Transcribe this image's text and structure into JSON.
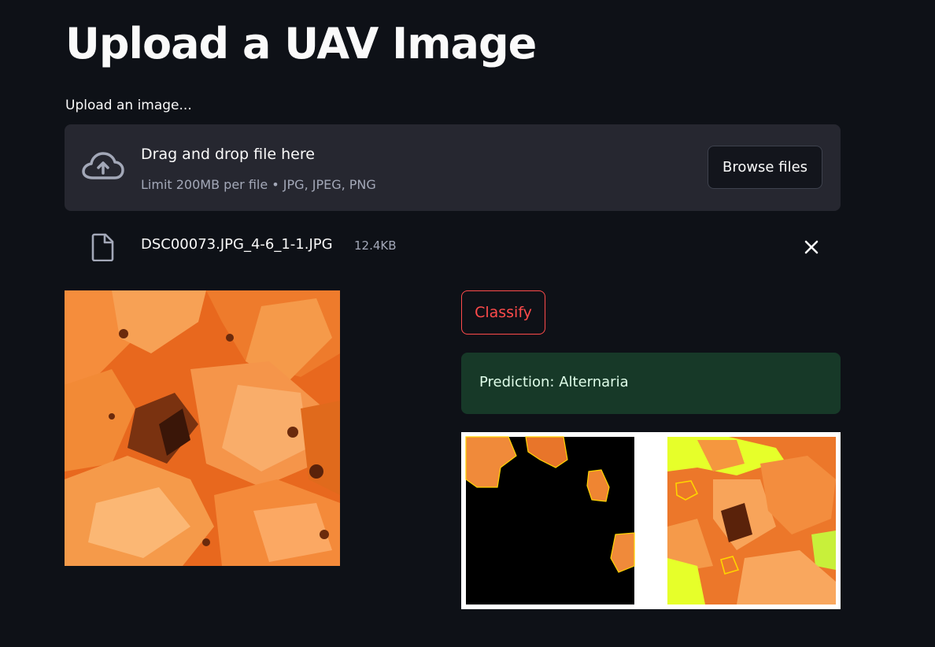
{
  "page": {
    "title": "Upload a UAV Image"
  },
  "uploader": {
    "label": "Upload an image...",
    "drop_title": "Drag and drop file here",
    "drop_subtitle": "Limit 200MB per file • JPG, JPEG, PNG",
    "browse_label": "Browse files",
    "icon": "cloud-upload-icon"
  },
  "uploaded_file": {
    "name": "DSC00073.JPG_4-6_1-1.JPG",
    "size": "12.4KB",
    "icon": "file-icon",
    "remove_icon": "close-icon"
  },
  "actions": {
    "classify_label": "Classify"
  },
  "result": {
    "prediction": "Prediction: Alternaria"
  },
  "colors": {
    "background": "#0e1117",
    "panel": "#262730",
    "accent": "#ff4b4b",
    "success_bg": "#173928",
    "success_text": "#dffde9",
    "leaf_orange": "#f07a2a",
    "lesion_highlight": "#e6ff2a"
  }
}
